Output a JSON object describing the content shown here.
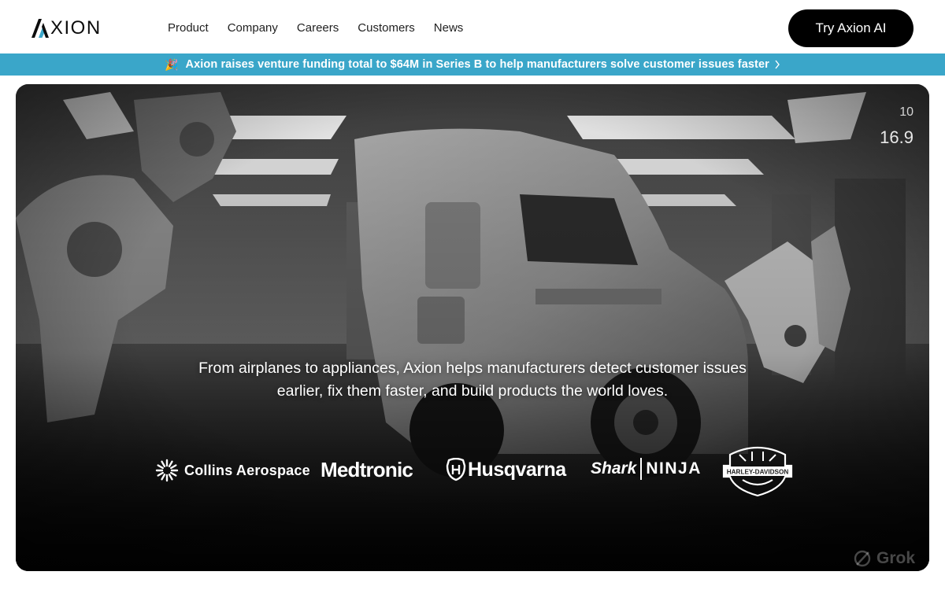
{
  "brand": {
    "name": "XION",
    "logo_icon": "axion-a-mark",
    "accent_color": "#3aa6c9"
  },
  "nav": {
    "items": [
      {
        "label": "Product"
      },
      {
        "label": "Company"
      },
      {
        "label": "Careers"
      },
      {
        "label": "Customers"
      },
      {
        "label": "News"
      }
    ],
    "cta_label": "Try Axion AI"
  },
  "announcement": {
    "emoji": "🎉",
    "text": "Axion raises venture funding total to $64M in Series B to help manufacturers solve customer issues faster",
    "icon": "chevron-right-icon",
    "background": "#3aa6c9"
  },
  "hero": {
    "background_image": "truck-in-robotic-factory",
    "hud_value": "16.9",
    "hud_top": "10",
    "tagline_line1": "From airplanes to appliances, Axion helps manufacturers detect customer issues",
    "tagline_line2": "earlier, fix them faster, and build products the world loves.",
    "customers": {
      "collins": "Collins Aerospace",
      "medtronic": "Medtronic",
      "husqvarna": "Husqvarna",
      "shark": "Shark",
      "ninja": "NINJA",
      "harley": "HARLEY-DAVIDSON"
    },
    "watermark": "Grok"
  }
}
